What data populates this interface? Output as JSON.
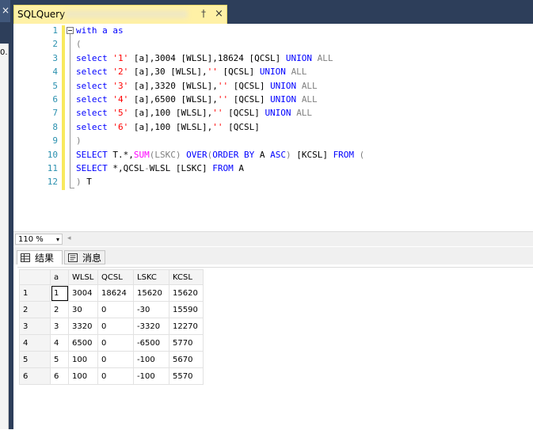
{
  "window": {
    "tab_title": "SQLQuery",
    "pin_glyph": "†",
    "close_glyph": "×",
    "left_strip_text": "0."
  },
  "editor": {
    "line_numbers": [
      "1",
      "2",
      "3",
      "4",
      "5",
      "6",
      "7",
      "8",
      "9",
      "10",
      "11",
      "12"
    ],
    "lines": [
      [
        {
          "t": "with a as",
          "c": "kw"
        }
      ],
      [
        {
          "t": "(",
          "c": "gray"
        }
      ],
      [
        {
          "t": "select ",
          "c": "kw"
        },
        {
          "t": "'1'",
          "c": "str"
        },
        {
          "t": " [a],3004 [WLSL],18624 [QCSL] ",
          "c": ""
        },
        {
          "t": "UNION ",
          "c": "kw"
        },
        {
          "t": "ALL",
          "c": "gray"
        }
      ],
      [
        {
          "t": "select ",
          "c": "kw"
        },
        {
          "t": "'2'",
          "c": "str"
        },
        {
          "t": " [a],30 [WLSL],",
          "c": ""
        },
        {
          "t": "''",
          "c": "str"
        },
        {
          "t": " [QCSL] ",
          "c": ""
        },
        {
          "t": "UNION ",
          "c": "kw"
        },
        {
          "t": "ALL",
          "c": "gray"
        }
      ],
      [
        {
          "t": "select ",
          "c": "kw"
        },
        {
          "t": "'3'",
          "c": "str"
        },
        {
          "t": " [a],3320 [WLSL],",
          "c": ""
        },
        {
          "t": "''",
          "c": "str"
        },
        {
          "t": " [QCSL] ",
          "c": ""
        },
        {
          "t": "UNION ",
          "c": "kw"
        },
        {
          "t": "ALL",
          "c": "gray"
        }
      ],
      [
        {
          "t": "select ",
          "c": "kw"
        },
        {
          "t": "'4'",
          "c": "str"
        },
        {
          "t": " [a],6500 [WLSL],",
          "c": ""
        },
        {
          "t": "''",
          "c": "str"
        },
        {
          "t": " [QCSL] ",
          "c": ""
        },
        {
          "t": "UNION ",
          "c": "kw"
        },
        {
          "t": "ALL",
          "c": "gray"
        }
      ],
      [
        {
          "t": "select ",
          "c": "kw"
        },
        {
          "t": "'5'",
          "c": "str"
        },
        {
          "t": " [a],100 [WLSL],",
          "c": ""
        },
        {
          "t": "''",
          "c": "str"
        },
        {
          "t": " [QCSL] ",
          "c": ""
        },
        {
          "t": "UNION ",
          "c": "kw"
        },
        {
          "t": "ALL",
          "c": "gray"
        }
      ],
      [
        {
          "t": "select ",
          "c": "kw"
        },
        {
          "t": "'6'",
          "c": "str"
        },
        {
          "t": " [a],100 [WLSL],",
          "c": ""
        },
        {
          "t": "''",
          "c": "str"
        },
        {
          "t": " [QCSL]",
          "c": ""
        }
      ],
      [
        {
          "t": ")",
          "c": "gray"
        }
      ],
      [
        {
          "t": "SELECT ",
          "c": "kw"
        },
        {
          "t": "T.*,",
          "c": ""
        },
        {
          "t": "SUM",
          "c": "fn"
        },
        {
          "t": "(LSKC) ",
          "c": "gray"
        },
        {
          "t": "OVER",
          "c": "kw"
        },
        {
          "t": "(",
          "c": "gray"
        },
        {
          "t": "ORDER BY ",
          "c": "kw"
        },
        {
          "t": "A ",
          "c": ""
        },
        {
          "t": "ASC",
          "c": "kw"
        },
        {
          "t": ") ",
          "c": "gray"
        },
        {
          "t": "[KCSL] ",
          "c": ""
        },
        {
          "t": "FROM",
          "c": "kw"
        },
        {
          "t": " (",
          "c": "gray"
        }
      ],
      [
        {
          "t": "SELECT ",
          "c": "kw"
        },
        {
          "t": "*,QCSL",
          "c": ""
        },
        {
          "t": "-",
          "c": "gray"
        },
        {
          "t": "WLSL [LSKC] ",
          "c": ""
        },
        {
          "t": "FROM ",
          "c": "kw"
        },
        {
          "t": "A",
          "c": ""
        }
      ],
      [
        {
          "t": ") ",
          "c": "gray"
        },
        {
          "t": "T",
          "c": ""
        }
      ]
    ]
  },
  "zoom": {
    "value": "110 %",
    "arrow": "▾"
  },
  "results_tabs": [
    {
      "label": "结果",
      "icon": "grid-icon",
      "active": true
    },
    {
      "label": "消息",
      "icon": "messages-icon",
      "active": false
    }
  ],
  "grid": {
    "columns": [
      "a",
      "WLSL",
      "QCSL",
      "LSKC",
      "KCSL"
    ],
    "rows": [
      {
        "num": "1",
        "cells": [
          "1",
          "3004",
          "18624",
          "15620",
          "15620"
        ]
      },
      {
        "num": "2",
        "cells": [
          "2",
          "30",
          "0",
          "-30",
          "15590"
        ]
      },
      {
        "num": "3",
        "cells": [
          "3",
          "3320",
          "0",
          "-3320",
          "12270"
        ]
      },
      {
        "num": "4",
        "cells": [
          "4",
          "6500",
          "0",
          "-6500",
          "5770"
        ]
      },
      {
        "num": "5",
        "cells": [
          "5",
          "100",
          "0",
          "-100",
          "5670"
        ]
      },
      {
        "num": "6",
        "cells": [
          "6",
          "100",
          "0",
          "-100",
          "5570"
        ]
      }
    ]
  }
}
